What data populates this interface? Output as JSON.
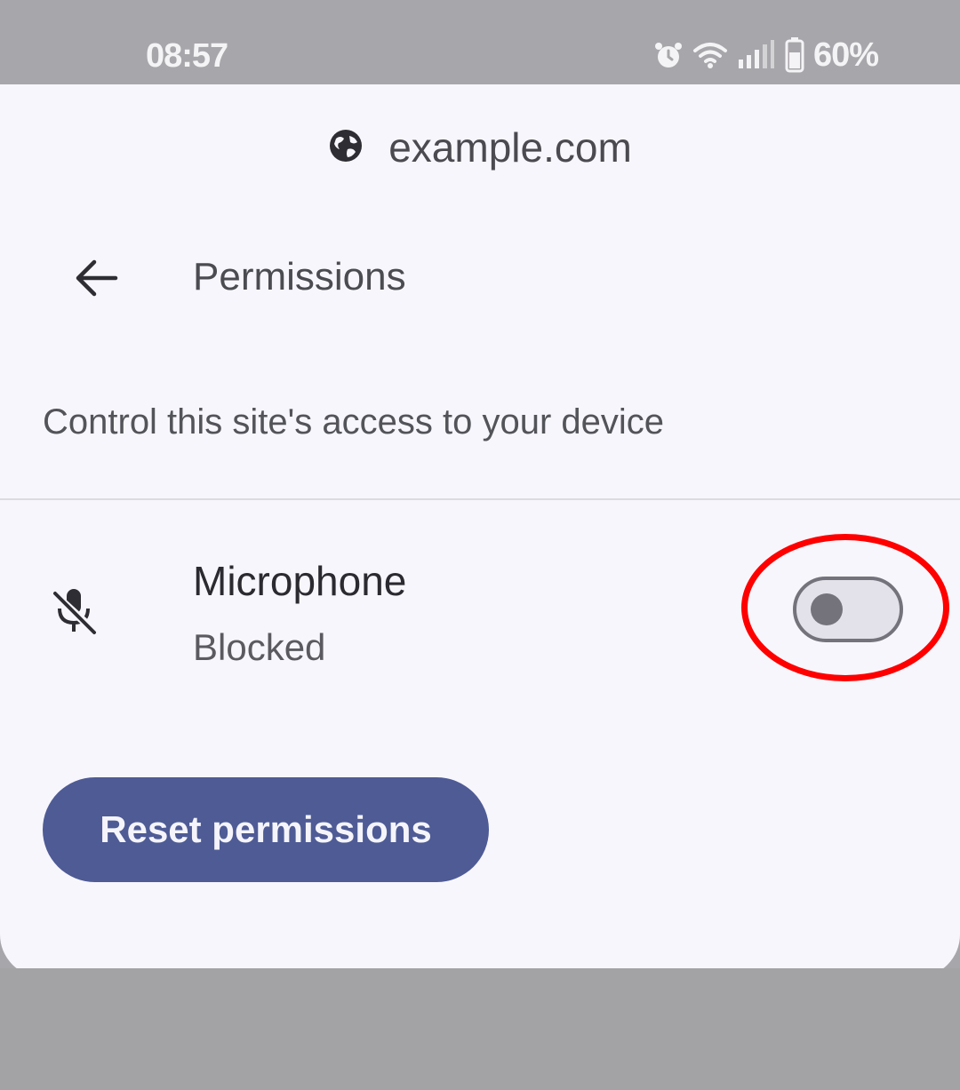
{
  "status_bar": {
    "time": "08:57",
    "icons": [
      "alarm-icon",
      "wifi-icon",
      "signal-icon",
      "battery-icon"
    ],
    "battery": "60%"
  },
  "site": {
    "icon": "globe-icon",
    "domain": "example.com"
  },
  "header": {
    "back_icon": "back-arrow-icon",
    "title": "Permissions"
  },
  "description": "Control this site's access to your device",
  "permissions": [
    {
      "icon": "microphone-off-icon",
      "name": "Microphone",
      "status": "Blocked",
      "enabled": false
    }
  ],
  "actions": {
    "reset_label": "Reset permissions"
  },
  "colors": {
    "accent_button": "#4e5b95",
    "annotation_ring": "#ff0000",
    "sheet_background": "#f7f6fc",
    "scrim": "#a7a6aa"
  }
}
